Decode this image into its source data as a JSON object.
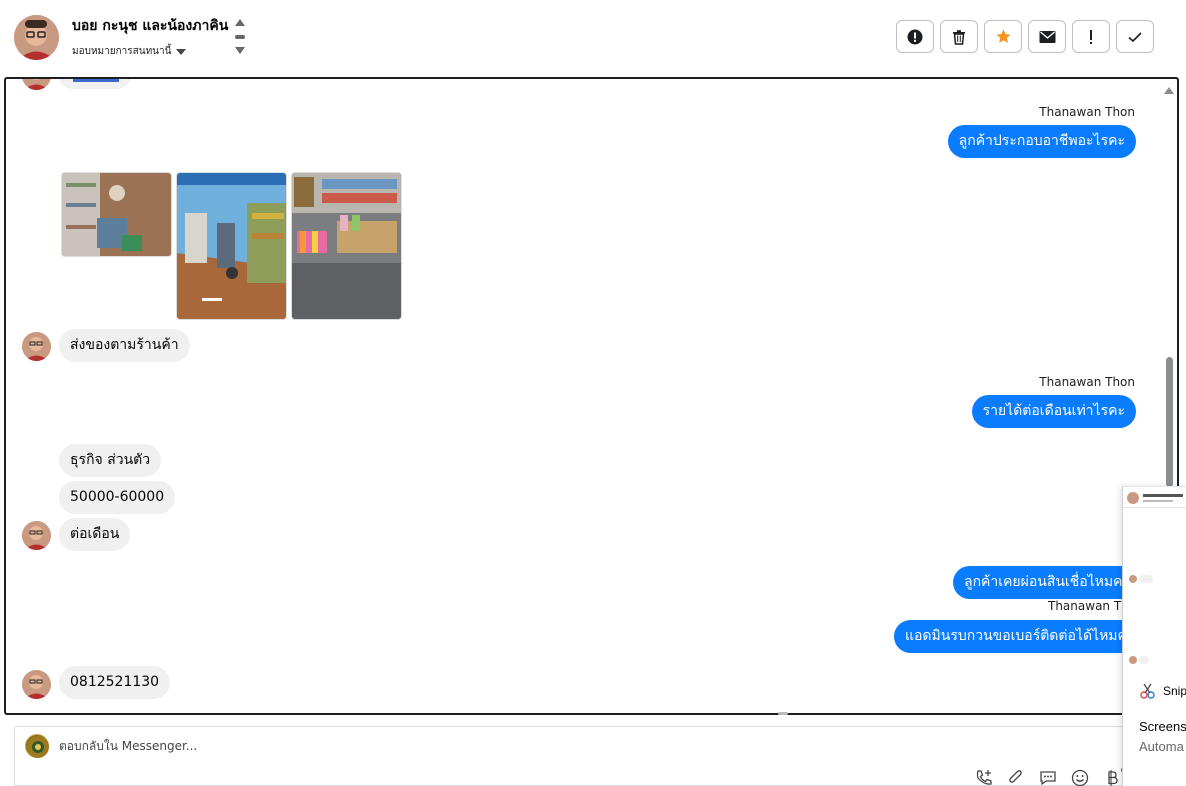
{
  "header": {
    "contact_name": "บอย กะนุช และน้องภาคิน",
    "assign_label": "มอบหมายการสนทนานี้"
  },
  "actions": [
    {
      "name": "spam-button",
      "icon": "exclamation-circle-icon"
    },
    {
      "name": "delete-button",
      "icon": "trash-icon"
    },
    {
      "name": "star-button",
      "icon": "star-icon"
    },
    {
      "name": "mark-unread-button",
      "icon": "envelope-icon"
    },
    {
      "name": "follow-up-button",
      "icon": "exclamation-icon"
    },
    {
      "name": "mark-done-button",
      "icon": "checkmark-icon"
    }
  ],
  "colors": {
    "outgoing": "#0a7cff",
    "incoming": "#f0f0f0",
    "star": "#f7931e"
  },
  "messages": [
    {
      "sender": "Thanawan Thon",
      "text": "ลูกค้าประกอบอาชีพอะไรคะ"
    },
    {
      "text": "ส่งของตามร้านค้า"
    },
    {
      "sender": "Thanawan Thon",
      "text": "รายได้ต่อเดือนเท่าไรคะ"
    },
    {
      "text": "ธุรกิจ ส่วนตัว"
    },
    {
      "text": "50000-60000"
    },
    {
      "text": "ต่อเดือน"
    },
    {
      "text": "ลูกค้าเคยผ่อนสินเชื่อไหมคะ"
    },
    {
      "sender": "Thanawan Thon",
      "text": "แอดมินรบกวนขอเบอร์ติดต่อได้ไหมคะ"
    },
    {
      "text": "0812521130"
    }
  ],
  "reply": {
    "placeholder": "ตอบกลับใน Messenger..."
  },
  "snip_panel": {
    "app": "Snip",
    "line1": "Screens",
    "line2": "Automa"
  }
}
